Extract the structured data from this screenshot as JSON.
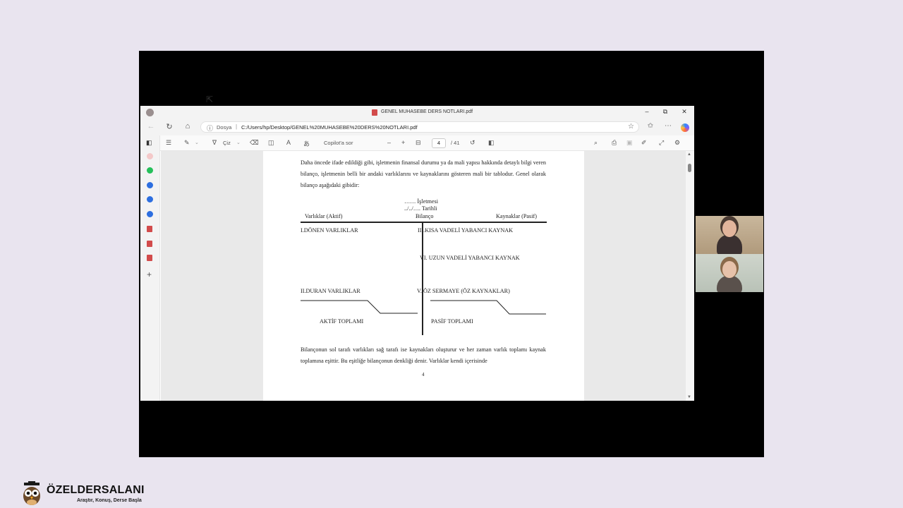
{
  "browser": {
    "tab_title": "GENEL MUHASEBE DERS NOTLARI.pdf",
    "address": {
      "site_label": "Dosya",
      "separator": "|",
      "url": "C:/Users/hp/Desktop/GENEL%20MUHASEBE%20DERS%20NOTLARI.pdf"
    },
    "window_buttons": {
      "minimize": "–",
      "restore": "⧉",
      "close": "✕"
    }
  },
  "pdf_toolbar": {
    "draw_label": "Çiz",
    "copilot_label": "Copilot'a sor",
    "zoom_out": "–",
    "zoom_in": "+",
    "page_current": "4",
    "page_total": "/ 41"
  },
  "document": {
    "intro": "Daha öncede ifade edildiği gibi, işletmenin finansal durumu ya da mali yapısı hakkında detaylı bilgi veren bilanço, işletmenin belli bir andaki varlıklarını ve kaynaklarını gösteren mali bir tablodur. Genel olarak bilanço aşağıdaki gibidir:",
    "balance_sheet": {
      "company_line": "…… İşletmesi",
      "date_line": "../../…. Tarihli",
      "title": "Bilanço",
      "left_header": "Varlıklar (Aktif)",
      "right_header": "Kaynaklar (Pasif)",
      "current_assets": "I.DÖNEN VARLIKLAR",
      "short_term_liabilities": "III.KISA VADELİ YABANCI KAYNAK",
      "long_term_liabilities": "VI. UZUN VADELİ YABANCI KAYNAK",
      "fixed_assets": "II.DURAN VARLIKLAR",
      "equity": "V. ÖZ SERMAYE (ÖZ KAYNAKLAR)",
      "total_assets": "AKTİF TOPLAMI",
      "total_liabilities": "PASİF TOPLAMI"
    },
    "closing": "Bilançonun sol tarafı varlıkları sağ tarafı ise kaynakları oluşturur ve her zaman varlık toplamı kaynak toplamına eşittir. Bu eşitliğe bilançonun denkliği denir. Varlıklar kendi içerisinde",
    "page_number": "4"
  },
  "brand": {
    "name": "ÖZELDERSALANI",
    "slogan": "Araştır, Konuş, Derse Başla"
  },
  "colors": {
    "stage": "#000000",
    "background": "#e9e4ef",
    "pdf_icon": "#d24b4b"
  }
}
